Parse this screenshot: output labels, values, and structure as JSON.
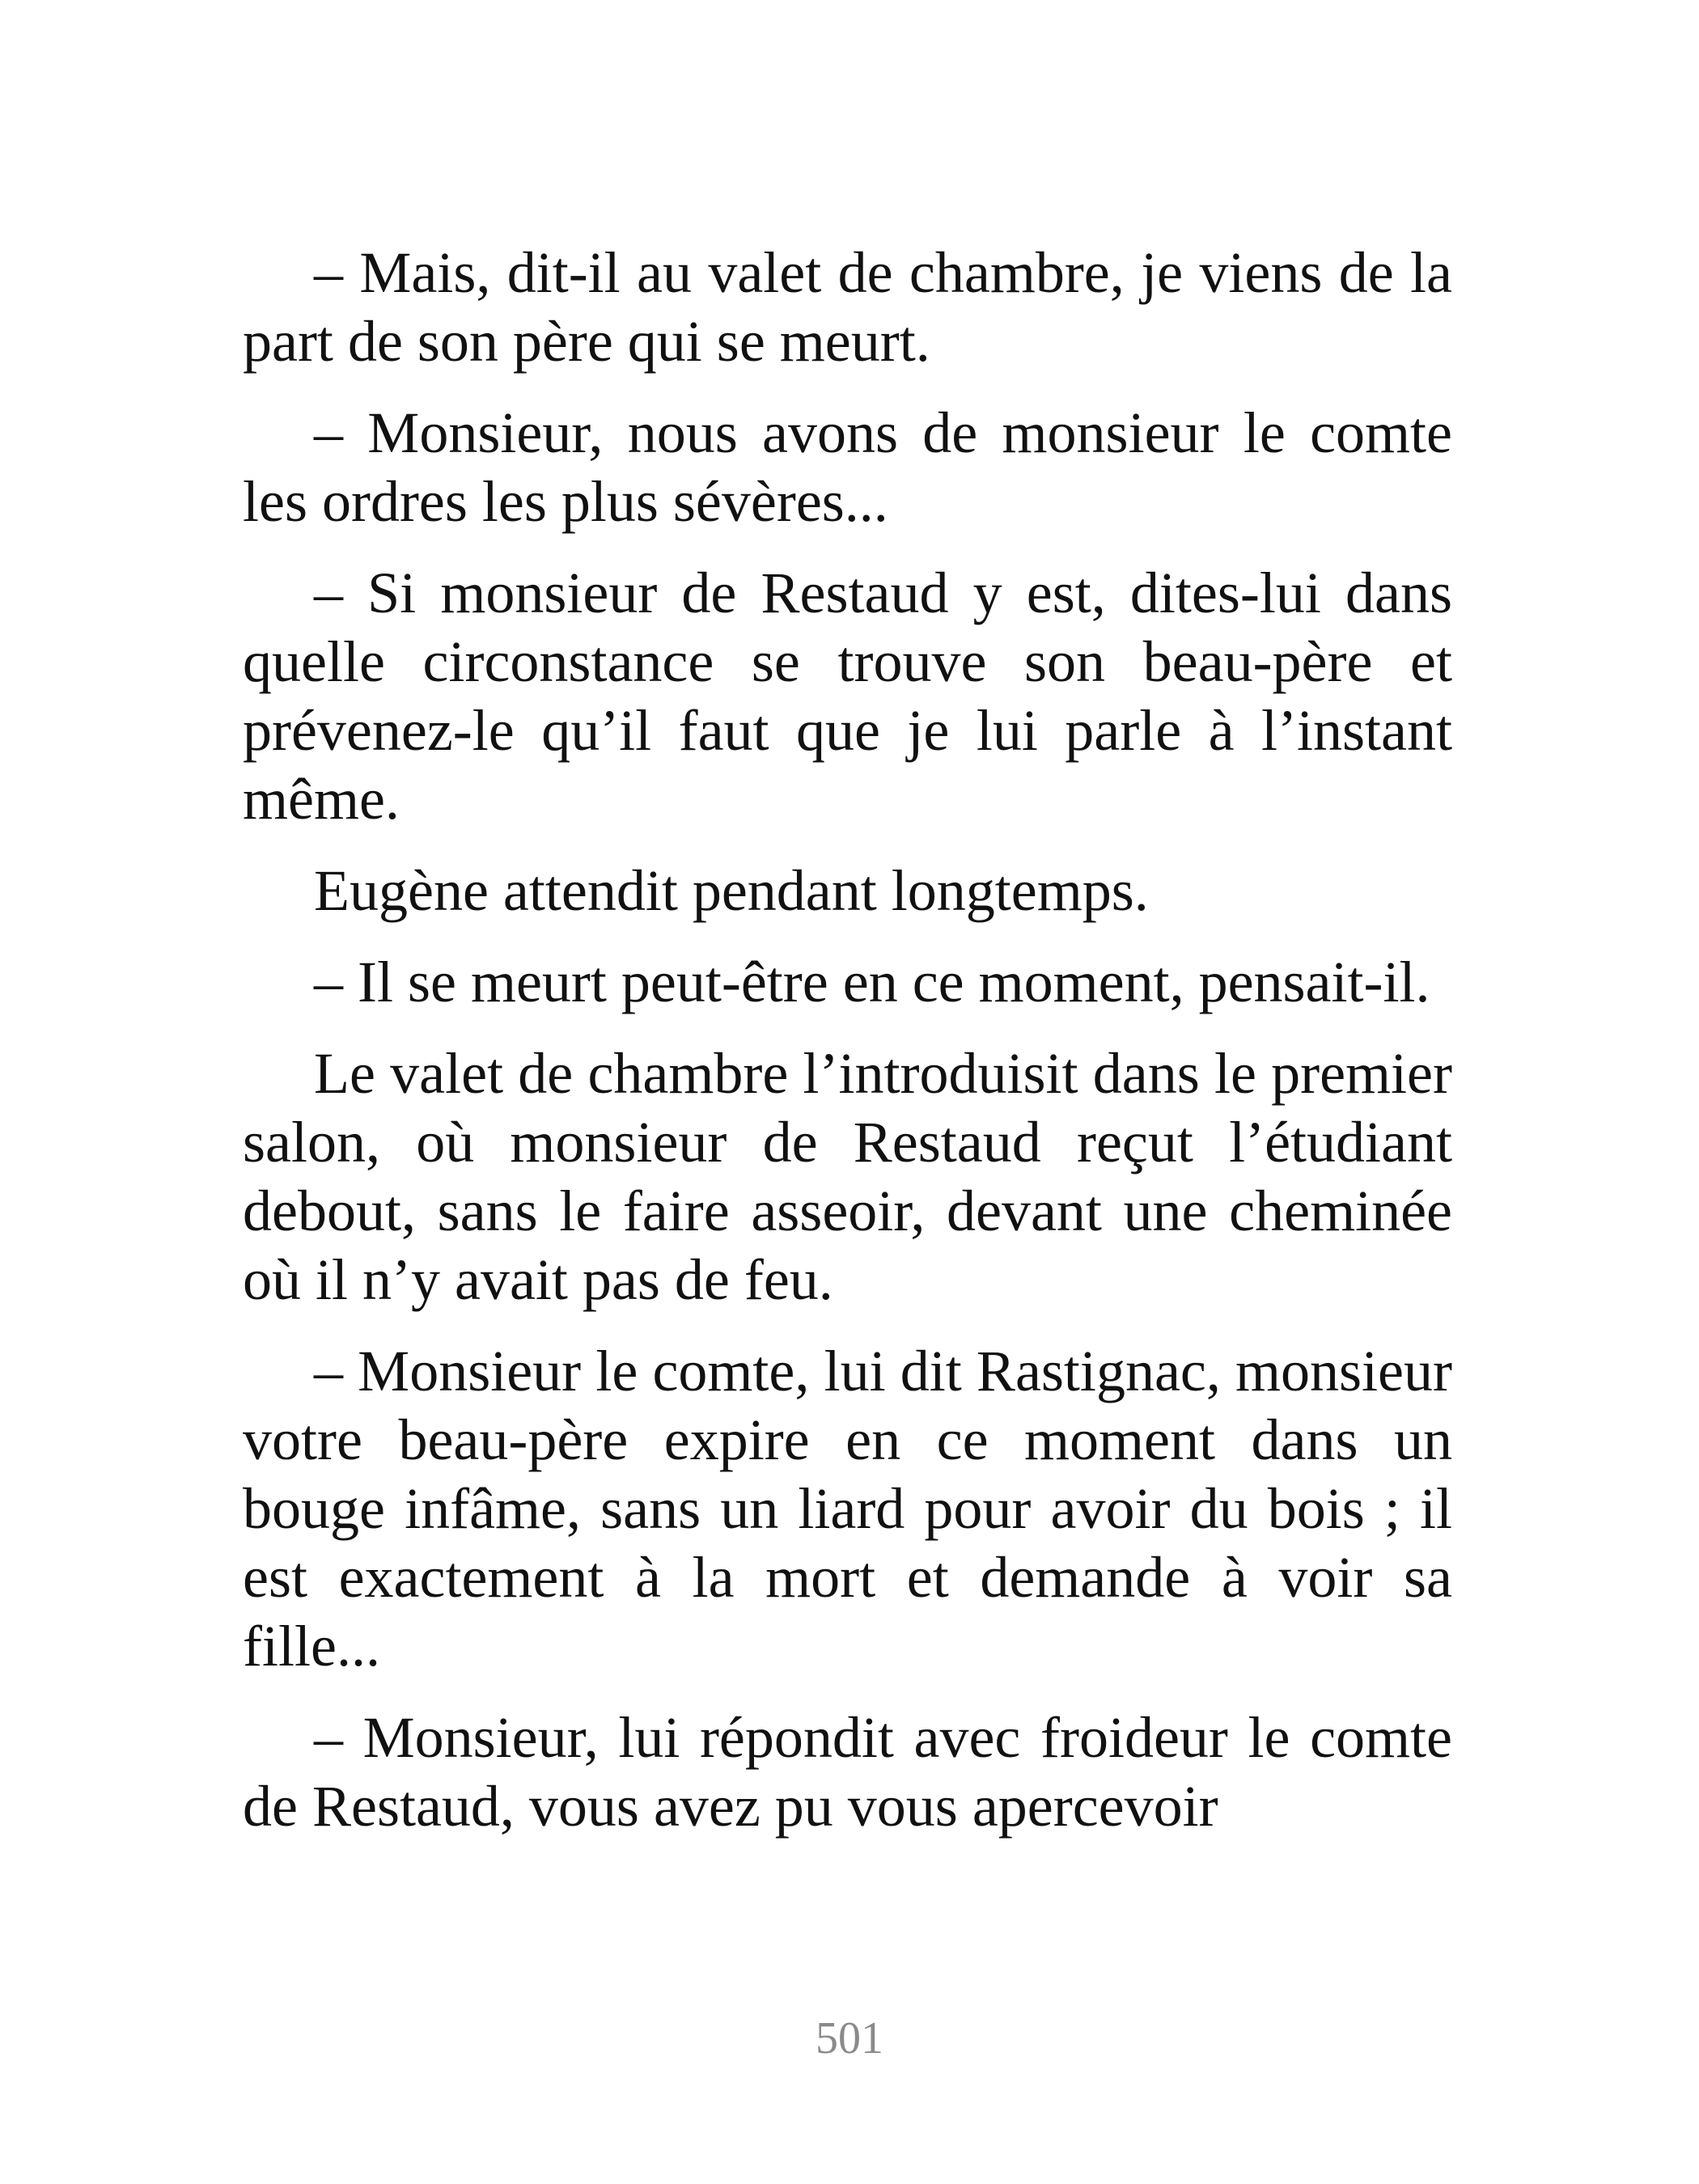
{
  "document": {
    "paragraphs": [
      "– Mais, dit-il au valet de chambre, je viens de la part de son père qui se meurt.",
      "– Monsieur, nous avons de monsieur le comte les ordres les plus sévères...",
      "– Si monsieur de Restaud y est, dites-lui dans quelle circonstance se trouve son beau-père et prévenez-le qu’il faut que je lui parle à l’instant même.",
      "Eugène attendit pendant longtemps.",
      "– Il se meurt peut-être en ce moment, pensait-il.",
      "Le valet de chambre l’introduisit dans le premier salon, où monsieur de Restaud reçut l’étudiant debout, sans le faire asseoir, devant une cheminée où il n’y avait pas de feu.",
      "– Monsieur le comte, lui dit Rastignac, monsieur votre beau-père expire en ce moment dans un bouge infâme, sans un liard pour avoir du bois ; il est exactement à la mort et demande à voir sa fille...",
      "– Monsieur, lui répondit avec froideur le comte de Restaud, vous avez pu vous apercevoir"
    ],
    "page_number": "501"
  }
}
